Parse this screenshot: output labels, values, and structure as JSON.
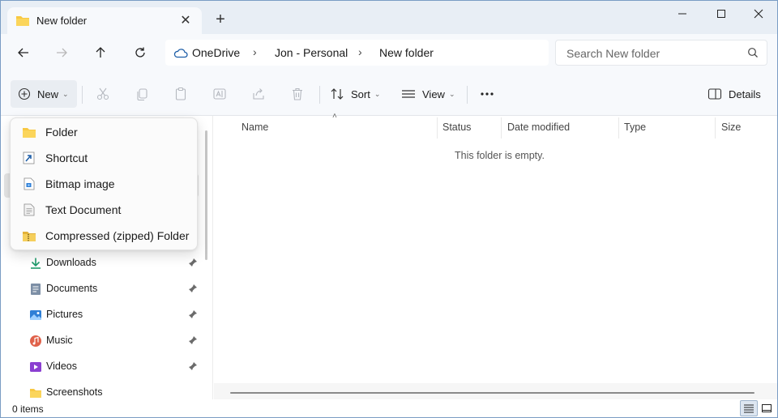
{
  "window": {
    "tab_title": "New folder",
    "new_tab_label": "+"
  },
  "address": {
    "crumbs": [
      "OneDrive",
      "Jon - Personal",
      "New folder"
    ],
    "search_placeholder": "Search New folder"
  },
  "toolbar": {
    "new_label": "New",
    "sort_label": "Sort",
    "view_label": "View",
    "details_label": "Details"
  },
  "new_menu": {
    "items": [
      {
        "label": "Folder",
        "icon": "folder-icon"
      },
      {
        "label": "Shortcut",
        "icon": "shortcut-icon"
      },
      {
        "label": "Bitmap image",
        "icon": "bitmap-icon"
      },
      {
        "label": "Text Document",
        "icon": "text-document-icon"
      },
      {
        "label": "Compressed (zipped) Folder",
        "icon": "zip-folder-icon"
      }
    ]
  },
  "sidebar": {
    "items": [
      {
        "label": "Downloads",
        "icon": "downloads-icon",
        "pinned": true
      },
      {
        "label": "Documents",
        "icon": "documents-icon",
        "pinned": true
      },
      {
        "label": "Pictures",
        "icon": "pictures-icon",
        "pinned": true
      },
      {
        "label": "Music",
        "icon": "music-icon",
        "pinned": true
      },
      {
        "label": "Videos",
        "icon": "videos-icon",
        "pinned": true
      },
      {
        "label": "Screenshots",
        "icon": "folder-icon",
        "pinned": false
      }
    ]
  },
  "content": {
    "columns": [
      "Name",
      "Status",
      "Date modified",
      "Type",
      "Size"
    ],
    "empty_message": "This folder is empty."
  },
  "status": {
    "item_count": "0 items"
  },
  "colors": {
    "folder": "#f8c842",
    "accent": "#0067c0",
    "titlebar": "#e8eef5"
  }
}
